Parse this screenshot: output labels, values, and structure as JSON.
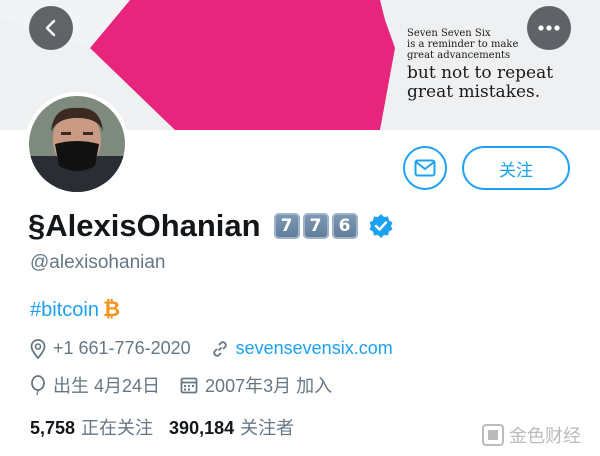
{
  "banner": {
    "small_lines": [
      "Seven Seven Six",
      "is a reminder to make",
      "great advancements"
    ],
    "big_lines": [
      "but not to repeat",
      "great mistakes."
    ],
    "accent_color": "#e8257d"
  },
  "nav": {
    "back_icon": "chevron-left-icon",
    "more_icon": "more-dots-icon"
  },
  "profile": {
    "name": "§AlexisOhanian",
    "keycaps": [
      "7",
      "7",
      "6"
    ],
    "handle": "@alexisohanian",
    "bio_tag": "#bitcoin",
    "bio_symbol": "₿",
    "phone": "+1 661-776-2020",
    "website": "sevensevensix.com",
    "birthday": "出生 4月24日",
    "joined": "2007年3月 加入"
  },
  "actions": {
    "follow_label": "关注",
    "message_icon": "envelope-icon"
  },
  "stats": {
    "following_count": "5,758",
    "following_label": "正在关注",
    "followers_count": "390,184",
    "followers_label": "关注者"
  },
  "watermark": {
    "text": "金色财经"
  },
  "colors": {
    "link": "#1da1f2",
    "secondary_text": "#657786",
    "primary_text": "#14171a",
    "bitcoin": "#f7931a"
  }
}
